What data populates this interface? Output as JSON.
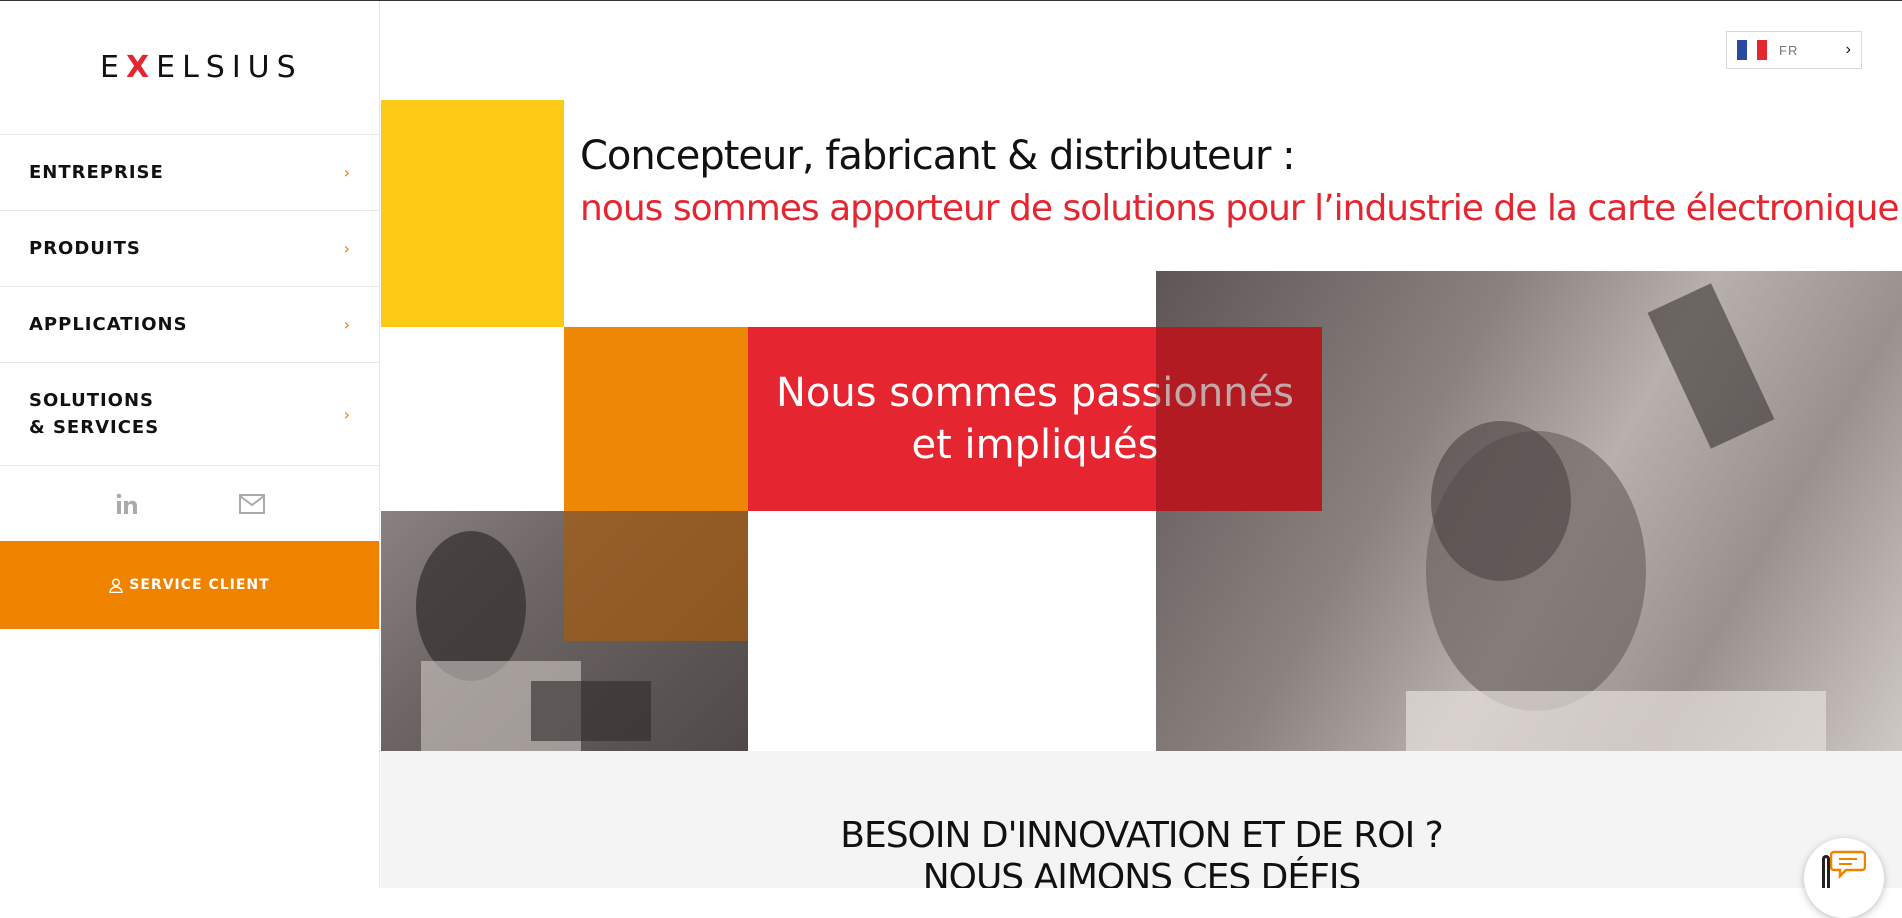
{
  "brand": {
    "logo_before": "E",
    "logo_x": "X",
    "logo_after": "ELSIUS"
  },
  "sidebar": {
    "items": [
      {
        "label": "ENTREPRISE",
        "chevron": "›"
      },
      {
        "label": "PRODUITS",
        "chevron": "›"
      },
      {
        "label": "APPLICATIONS",
        "chevron": "›"
      },
      {
        "label": "SOLUTIONS\n& SERVICES",
        "chevron": "›"
      }
    ],
    "social": [
      "linkedin-icon",
      "mail-icon"
    ],
    "service_label": "SERVICE CLIENT"
  },
  "language": {
    "code": "FR",
    "chevron": "›",
    "flag_colors": [
      "#2a4aa0",
      "#ffffff",
      "#e5252f"
    ]
  },
  "hero": {
    "line1": "Concepteur, fabricant & distributeur :",
    "line2": "nous sommes apporteur de solutions pour l’industrie de la carte électronique",
    "line2_end": ".",
    "tagline": "Nous sommes passionnés et impliqués"
  },
  "section": {
    "title_line1": "BESOIN D'INNOVATION ET DE ROI ?",
    "title_line2": "NOUS AIMONS CES DÉFIS"
  },
  "colors": {
    "accent_orange": "#ef8300",
    "red": "#e5252f",
    "yellow": "#fdcb16"
  }
}
